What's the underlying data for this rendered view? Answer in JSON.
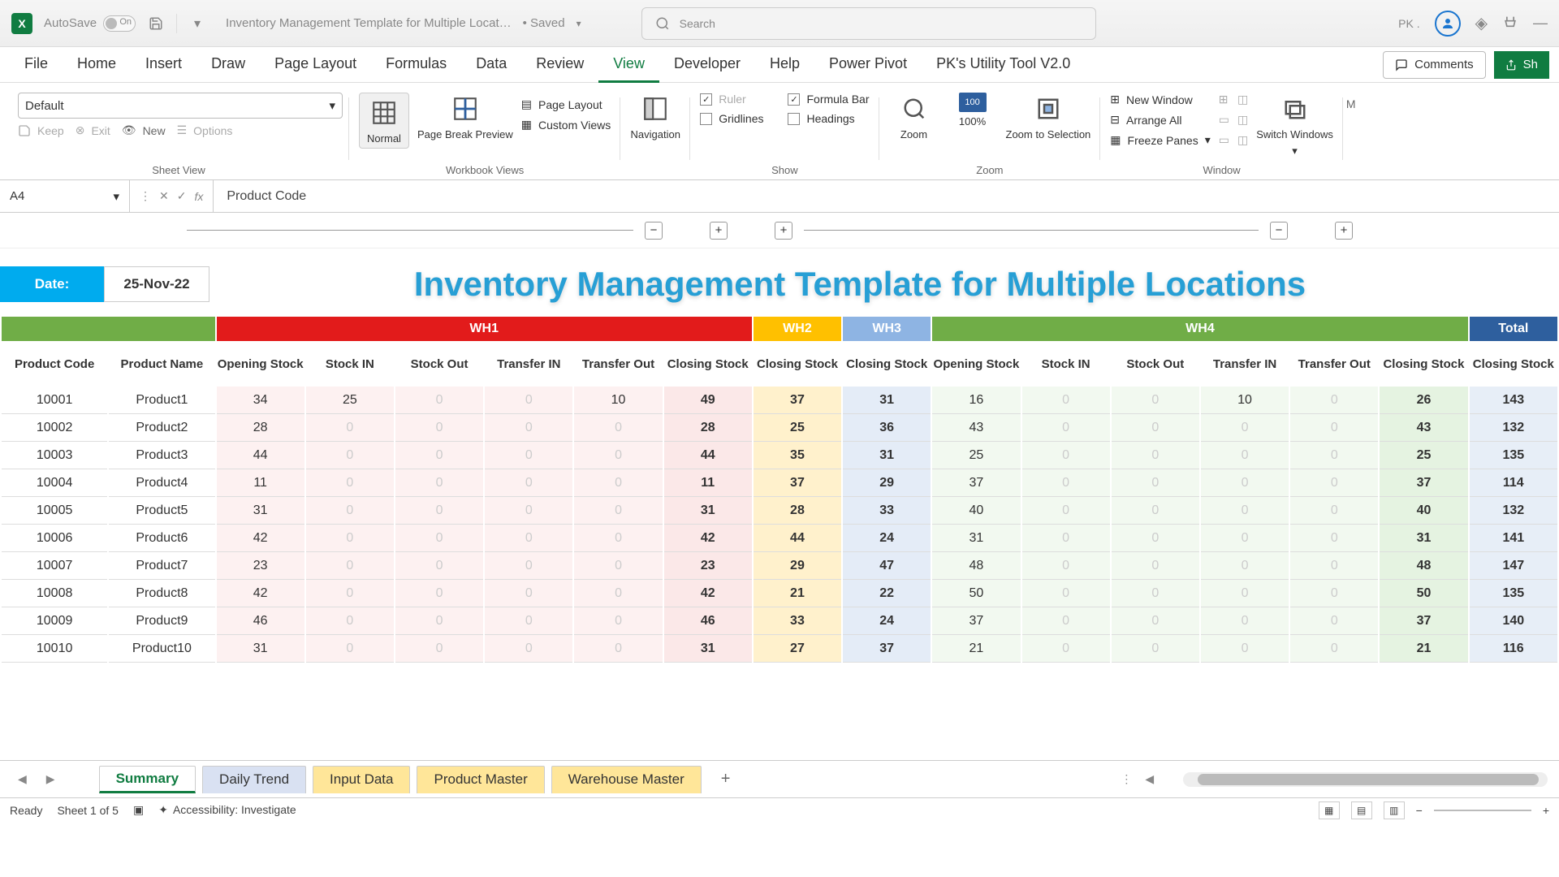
{
  "titlebar": {
    "autosave_label": "AutoSave",
    "autosave_state": "On",
    "file_name": "Inventory Management Template for Multiple Locat…",
    "saved": "• Saved",
    "search_placeholder": "Search",
    "user_initials": "PK ."
  },
  "tabs": {
    "items": [
      "File",
      "Home",
      "Insert",
      "Draw",
      "Page Layout",
      "Formulas",
      "Data",
      "Review",
      "View",
      "Developer",
      "Help",
      "Power Pivot",
      "PK's Utility Tool V2.0"
    ],
    "active": "View",
    "comments": "Comments",
    "share": "Sh"
  },
  "ribbon": {
    "sheet_view": {
      "default": "Default",
      "keep": "Keep",
      "exit": "Exit",
      "new": "New",
      "options": "Options",
      "label": "Sheet View"
    },
    "workbook_views": {
      "normal": "Normal",
      "page_break": "Page Break Preview",
      "page_layout": "Page Layout",
      "custom": "Custom Views",
      "label": "Workbook Views"
    },
    "navigation": {
      "nav": "Navigation"
    },
    "show": {
      "ruler": "Ruler",
      "formula_bar": "Formula Bar",
      "gridlines": "Gridlines",
      "headings": "Headings",
      "label": "Show"
    },
    "zoom": {
      "zoom": "Zoom",
      "hundred": "100%",
      "selection": "Zoom to Selection",
      "label": "Zoom"
    },
    "window": {
      "new_window": "New Window",
      "arrange": "Arrange All",
      "freeze": "Freeze Panes",
      "switch": "Switch Windows",
      "label": "Window",
      "m": "M"
    }
  },
  "formula_bar": {
    "cell": "A4",
    "fx": "fx",
    "value": "Product Code"
  },
  "sheet": {
    "date_label": "Date:",
    "date_value": "25-Nov-22",
    "title": "Inventory Management Template for Multiple Locations",
    "group_headers": [
      "",
      "WH1",
      "WH2",
      "WH3",
      "WH4",
      "Total"
    ],
    "col_headers": {
      "pc": "Product Code",
      "pn": "Product Name",
      "os": "Opening Stock",
      "sin": "Stock IN",
      "sout": "Stock Out",
      "tin": "Transfer IN",
      "tout": "Transfer Out",
      "cs": "Closing Stock"
    },
    "rows": [
      {
        "code": "10001",
        "name": "Product1",
        "wh1": [
          34,
          25,
          0,
          0,
          10,
          49
        ],
        "wh2": 37,
        "wh3": 31,
        "wh4": [
          16,
          0,
          0,
          10,
          0,
          26
        ],
        "total": 143
      },
      {
        "code": "10002",
        "name": "Product2",
        "wh1": [
          28,
          0,
          0,
          0,
          0,
          28
        ],
        "wh2": 25,
        "wh3": 36,
        "wh4": [
          43,
          0,
          0,
          0,
          0,
          43
        ],
        "total": 132
      },
      {
        "code": "10003",
        "name": "Product3",
        "wh1": [
          44,
          0,
          0,
          0,
          0,
          44
        ],
        "wh2": 35,
        "wh3": 31,
        "wh4": [
          25,
          0,
          0,
          0,
          0,
          25
        ],
        "total": 135
      },
      {
        "code": "10004",
        "name": "Product4",
        "wh1": [
          11,
          0,
          0,
          0,
          0,
          11
        ],
        "wh2": 37,
        "wh3": 29,
        "wh4": [
          37,
          0,
          0,
          0,
          0,
          37
        ],
        "total": 114
      },
      {
        "code": "10005",
        "name": "Product5",
        "wh1": [
          31,
          0,
          0,
          0,
          0,
          31
        ],
        "wh2": 28,
        "wh3": 33,
        "wh4": [
          40,
          0,
          0,
          0,
          0,
          40
        ],
        "total": 132
      },
      {
        "code": "10006",
        "name": "Product6",
        "wh1": [
          42,
          0,
          0,
          0,
          0,
          42
        ],
        "wh2": 44,
        "wh3": 24,
        "wh4": [
          31,
          0,
          0,
          0,
          0,
          31
        ],
        "total": 141
      },
      {
        "code": "10007",
        "name": "Product7",
        "wh1": [
          23,
          0,
          0,
          0,
          0,
          23
        ],
        "wh2": 29,
        "wh3": 47,
        "wh4": [
          48,
          0,
          0,
          0,
          0,
          48
        ],
        "total": 147
      },
      {
        "code": "10008",
        "name": "Product8",
        "wh1": [
          42,
          0,
          0,
          0,
          0,
          42
        ],
        "wh2": 21,
        "wh3": 22,
        "wh4": [
          50,
          0,
          0,
          0,
          0,
          50
        ],
        "total": 135
      },
      {
        "code": "10009",
        "name": "Product9",
        "wh1": [
          46,
          0,
          0,
          0,
          0,
          46
        ],
        "wh2": 33,
        "wh3": 24,
        "wh4": [
          37,
          0,
          0,
          0,
          0,
          37
        ],
        "total": 140
      },
      {
        "code": "10010",
        "name": "Product10",
        "wh1": [
          31,
          0,
          0,
          0,
          0,
          31
        ],
        "wh2": 27,
        "wh3": 37,
        "wh4": [
          21,
          0,
          0,
          0,
          0,
          21
        ],
        "total": 116
      }
    ]
  },
  "sheet_tabs": {
    "items": [
      "Summary",
      "Daily Trend",
      "Input Data",
      "Product Master",
      "Warehouse Master"
    ],
    "active": "Summary"
  },
  "status": {
    "ready": "Ready",
    "sheet": "Sheet 1 of 5",
    "accessibility": "Accessibility: Investigate",
    "zoom": "+"
  }
}
